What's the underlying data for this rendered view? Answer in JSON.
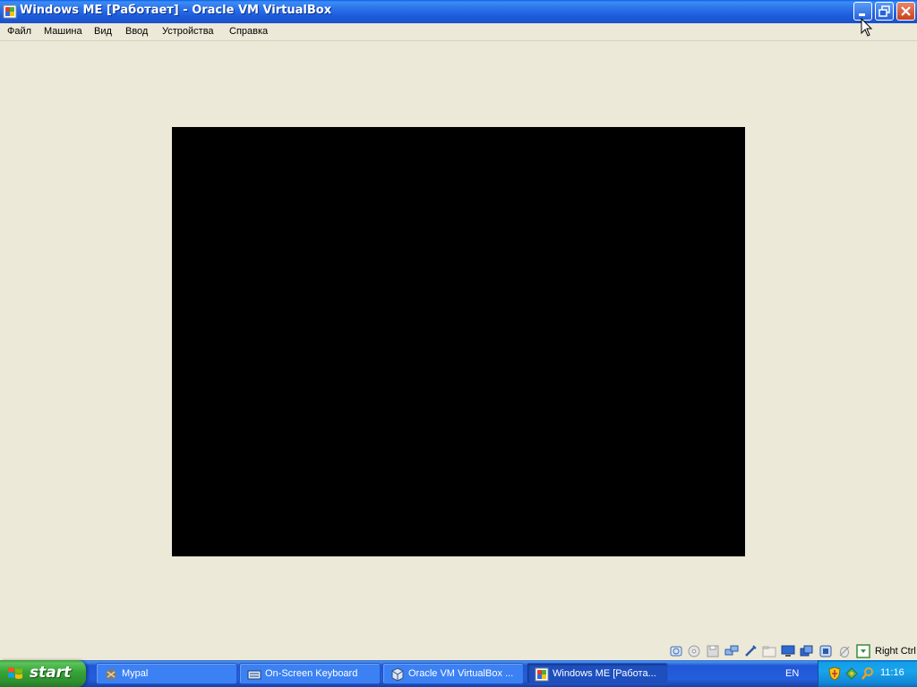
{
  "window": {
    "title": "Windows ME [Работает] - Oracle VM VirtualBox",
    "icon": "virtualbox-vm-icon",
    "controls": [
      "minimize-icon",
      "restore-icon",
      "close-icon"
    ]
  },
  "menu": {
    "items": [
      "Файл",
      "Машина",
      "Вид",
      "Ввод",
      "Устройства",
      "Справка"
    ]
  },
  "vm_screen": {
    "color": "#000000"
  },
  "statusbar": {
    "icons": [
      "hard-disk-icon",
      "optical-drive-icon",
      "floppy-disk-icon",
      "network-icon",
      "usb-icon",
      "shared-folders-icon",
      "display-icon",
      "video-capture-icon",
      "cpu-virtualization-icon",
      "mouse-integration-icon",
      "keyboard-capture-icon"
    ],
    "host_key": "Right Ctrl"
  },
  "taskbar": {
    "start_label": "start",
    "tasks": [
      {
        "label": "Mypal",
        "icon": "mypal-browser-icon",
        "active": false
      },
      {
        "label": "On-Screen Keyboard",
        "icon": "keyboard-icon",
        "active": false
      },
      {
        "label": "Oracle VM VirtualBox ...",
        "icon": "virtualbox-icon",
        "active": false
      },
      {
        "label": "Windows ME [Работа...",
        "icon": "virtualbox-vm-icon",
        "active": true
      }
    ],
    "language": "EN",
    "tray_icons": [
      "security-shield-icon",
      "network-tray-icon",
      "search-tray-icon"
    ],
    "clock": "11:16"
  },
  "colors": {
    "titlebar": "#245EDC",
    "window_bg": "#ECE9D8",
    "start_green": "#36A336",
    "tray_blue": "#18A4EC"
  }
}
